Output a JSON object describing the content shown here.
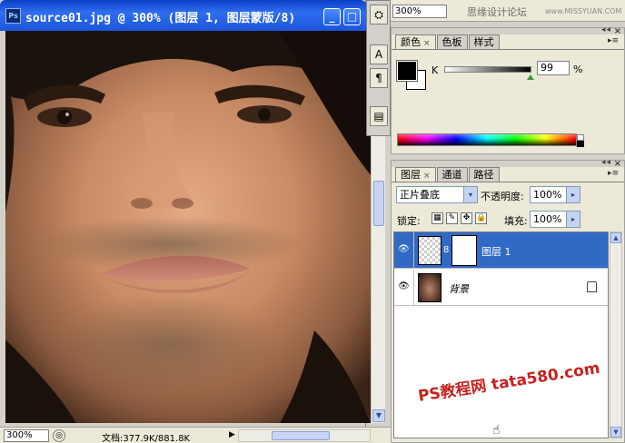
{
  "document": {
    "title": "source01.jpg @ 300% (图层 1, 图层蒙版/8)",
    "app_icon": "Ps",
    "minimize_glyph": "_",
    "maximize_glyph": "□",
    "status": {
      "zoom": "300%",
      "doc_size": "文档:377.9K/881.8K",
      "nav_glyph": "◎",
      "arrow_glyph": "▶"
    }
  },
  "tools": [
    {
      "name": "tool-preset",
      "glyph": "⛭"
    },
    {
      "name": "character",
      "glyph": "A"
    },
    {
      "name": "paragraph",
      "glyph": "¶"
    },
    {
      "name": "notes",
      "glyph": "▤"
    }
  ],
  "options": {
    "zoom_field": "300%",
    "site_text": "思缘设计论坛",
    "site_url": "www.MISSYUAN.COM"
  },
  "color_panel": {
    "tabs": [
      "颜色",
      "色板",
      "样式"
    ],
    "close_glyph": "×",
    "menu_glyph": "▸≡",
    "k_label": "K",
    "k_value": "99",
    "k_unit": "%",
    "k_fraction": 0.99
  },
  "layers_panel": {
    "tabs": [
      "图层",
      "通道",
      "路径"
    ],
    "close_glyph": "×",
    "menu_glyph": "▸≡",
    "blend_mode": "正片叠底",
    "opacity_label": "不透明度:",
    "opacity_value": "100%",
    "lock_label": "锁定:",
    "fill_label": "填充:",
    "fill_value": "100%",
    "dropdown_glyph": "▾",
    "arrow_glyph": "▸",
    "eye_glyph": "👁",
    "chain_glyph": "8",
    "lock_glyph": "🔒",
    "lock_icons": [
      "▦",
      "✎",
      "✥",
      "🔒"
    ],
    "layers": [
      {
        "name": "图层 1",
        "selected": true,
        "has_mask": true
      },
      {
        "name": "背景",
        "selected": false,
        "locked": true
      }
    ],
    "bottom_buttons": [
      "ⅽⅽ",
      "ƒ",
      "◙",
      "◐",
      "▭",
      "▢",
      "🗑"
    ]
  },
  "watermark": "PS教程网 tata580.com",
  "colors": {
    "titlebar": "#1c55dc",
    "selected_row": "#316ac5",
    "panel_bg": "#ece9d8",
    "watermark": "#c8211c"
  }
}
